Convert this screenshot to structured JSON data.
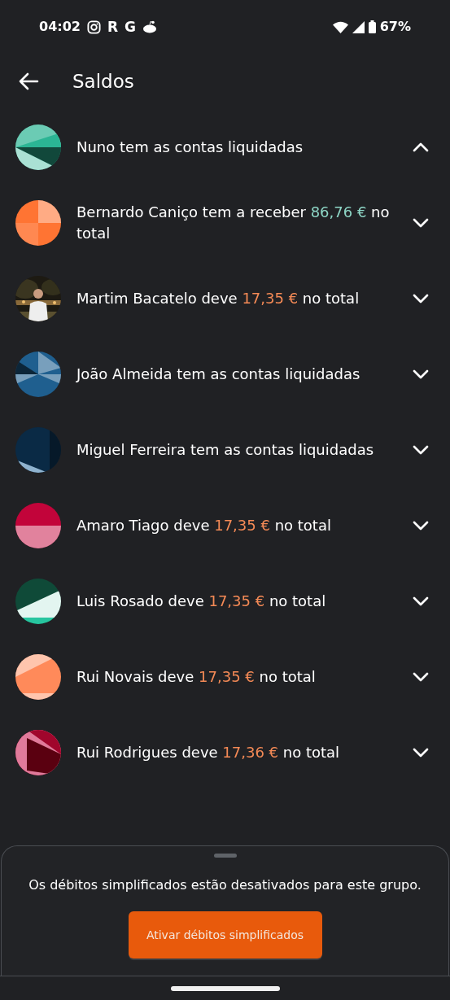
{
  "status_bar": {
    "time": "04:02",
    "app_letters": [
      "R",
      "G"
    ],
    "battery": "67%"
  },
  "app_bar": {
    "title": "Saldos"
  },
  "balances": [
    {
      "kind": "pattern",
      "color": "#2bb594",
      "before": "Nuno tem as contas liquidadas",
      "expanded": true
    },
    {
      "kind": "pattern",
      "color": "#ff7433",
      "before": "Bernardo Caniço tem a receber ",
      "amount": {
        "text": "86,76 €",
        "kind": "credit"
      },
      "after": " no total",
      "expanded": false
    },
    {
      "before": "Martim Bacatelo deve ",
      "amount": {
        "text": "17,35 €",
        "kind": "debt"
      },
      "after": " no total",
      "expanded": false
    },
    {
      "kind": "pattern",
      "color": "#1f5f8f",
      "before": "João Almeida tem as contas liquidadas",
      "expanded": false
    },
    {
      "kind": "pattern",
      "color": "#0a2a45",
      "before": "Miguel Ferreira tem as contas liquidadas",
      "expanded": false
    },
    {
      "kind": "pattern",
      "color": "#c2043a",
      "before": "Amaro Tiago deve ",
      "amount": {
        "text": "17,35 €",
        "kind": "debt"
      },
      "after": " no total",
      "expanded": false
    },
    {
      "kind": "pattern",
      "color": "#0f4a38",
      "before": "Luis Rosado deve ",
      "amount": {
        "text": "17,35 €",
        "kind": "debt"
      },
      "after": " no total",
      "expanded": false
    },
    {
      "kind": "pattern",
      "color": "#ff8a5a",
      "before": "Rui Novais deve ",
      "amount": {
        "text": "17,35 €",
        "kind": "debt"
      },
      "after": " no total",
      "expanded": false
    },
    {
      "kind": "pattern",
      "color": "#a0062c",
      "before": "Rui Rodrigues deve ",
      "amount": {
        "text": "17,36 €",
        "kind": "debt"
      },
      "after": " no total",
      "expanded": false
    }
  ],
  "sheet": {
    "message": "Os débitos simplificados estão desativados para este grupo.",
    "button": "Ativar débitos simplificados"
  }
}
